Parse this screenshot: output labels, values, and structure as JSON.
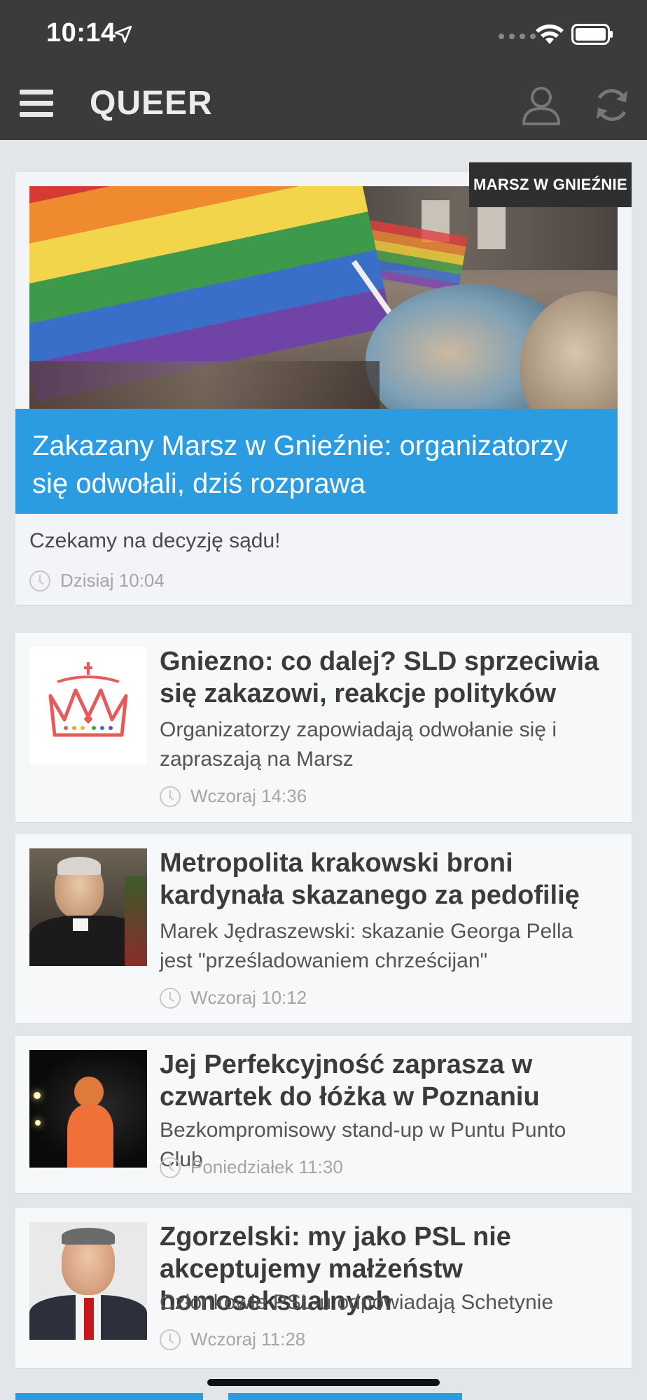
{
  "status_bar": {
    "time": "10:14"
  },
  "app_bar": {
    "brand": "QUEER"
  },
  "featured": {
    "tag": "MARSZ W GNIEŹNIE",
    "title": "Zakazany Marsz w Gnieźnie: organizatorzy się odwołali, dziś rozprawa",
    "lead": "Czekamy na decyzję sądu!",
    "time": "Dzisiaj 10:04"
  },
  "articles": [
    {
      "title": "Gniezno: co dalej? SLD sprzeciwia się zakazowi, reakcje polityków",
      "lead": "Organizatorzy zapowiadają odwołanie się i zapraszają na Marsz",
      "time": "Wczoraj 14:36"
    },
    {
      "title": "Metropolita krakowski broni kardynała skazanego za pedofilię",
      "lead": "Marek Jędraszewski: skazanie Georga Pella jest \"prześladowaniem chrześcijan\"",
      "time": "Wczoraj 10:12"
    },
    {
      "title": "Jej Perfekcyjność zaprasza w czwartek do łóżka w Poznaniu",
      "lead": "Bezkompromisowy stand-up w Puntu Punto Club",
      "time": "Poniedziałek 11:30"
    },
    {
      "title": "Zgorzelski: my jako PSL nie akceptujemy małżeństw homoseksualnych",
      "lead": "Członkowie PSL-u odpowiadają Schetynie",
      "time": "Wczoraj 11:28"
    }
  ],
  "colors": {
    "accent": "#2b9be2",
    "appbar": "#3b3b3b"
  }
}
